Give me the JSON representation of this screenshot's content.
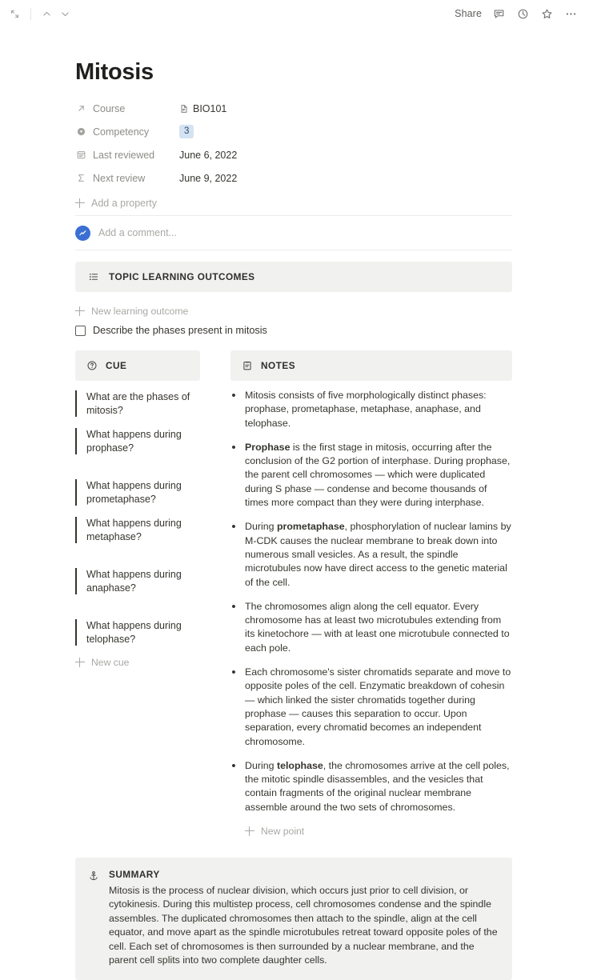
{
  "topbar": {
    "left_icons": [
      {
        "name": "expand-collapse-icon"
      },
      {
        "name": "chevron-up-icon"
      },
      {
        "name": "chevron-down-icon"
      }
    ],
    "share_label": "Share",
    "right_icons": [
      {
        "name": "comment-icon"
      },
      {
        "name": "history-clock-icon"
      },
      {
        "name": "star-icon"
      },
      {
        "name": "more-options-icon"
      }
    ]
  },
  "page": {
    "title": "Mitosis",
    "properties": [
      {
        "icon": "relation-arrow-icon",
        "name": "Course",
        "type": "relation",
        "value": "BIO101"
      },
      {
        "icon": "select-circle-icon",
        "name": "Competency",
        "type": "badge",
        "value": "3"
      },
      {
        "icon": "calendar-icon",
        "name": "Last reviewed",
        "type": "text",
        "value": "June 6, 2022"
      },
      {
        "icon": "sigma-formula-icon",
        "name": "Next review",
        "type": "text",
        "value": "June 9, 2022"
      }
    ],
    "add_property_label": "Add a property",
    "comment_placeholder": "Add a comment..."
  },
  "learning_outcomes": {
    "header_icon": "bulleted-list-icon",
    "header_label": "TOPIC LEARNING OUTCOMES",
    "add_label": "New learning outcome",
    "items": [
      {
        "checked": false,
        "text": "Describe the phases present in mitosis"
      }
    ]
  },
  "cue": {
    "header_icon": "question-circle-icon",
    "header_label": "CUE",
    "items": [
      "What are the phases of mitosis?",
      "What happens during prophase?",
      "What happens during prometaphase?",
      "What happens during metaphase?",
      "What happens during anaphase?",
      "What happens during telophase?"
    ],
    "add_label": "New cue"
  },
  "notes": {
    "header_icon": "clipboard-notes-icon",
    "header_label": "NOTES",
    "items": [
      {
        "html": "Mitosis consists of five morphologically distinct phases: prophase, prometaphase, metaphase, anaphase, and telophase."
      },
      {
        "html": "<b>Prophase</b> is the first stage in mitosis, occurring after the conclusion of the G2 portion of interphase. During prophase, the parent cell chromosomes &mdash; which were duplicated during S phase &mdash; condense and become thousands of times more compact than they were during interphase."
      },
      {
        "html": "During <b>prometaphase</b>, phosphorylation of nuclear lamins by M-CDK causes the nuclear membrane to break down into numerous small vesicles. As a result, the spindle microtubules now have direct access to the genetic material of the cell."
      },
      {
        "html": "The chromosomes align along the cell equator. Every chromosome has at least two microtubules extending from its kinetochore &mdash; with at least one microtubule connected to each pole."
      },
      {
        "html": "Each chromosome's sister chromatids separate and move to opposite poles of the cell. Enzymatic breakdown of cohesin &mdash; which linked the sister chromatids together during prophase &mdash; causes this separation to occur. Upon separation, every chromatid becomes an independent chromosome."
      },
      {
        "html": "During <b>telophase</b>, the chromosomes arrive at the cell poles, the mitotic spindle disassembles, and the vesicles that contain fragments of the original nuclear membrane assemble around the two sets of chromosomes."
      }
    ],
    "add_label": "New point"
  },
  "summary": {
    "header_icon": "anchor-icon",
    "header_label": "SUMMARY",
    "body": "Mitosis is the process of nuclear division, which occurs just prior to cell division, or cytokinesis. During this multistep process, cell chromosomes condense and the spindle assembles. The duplicated chromosomes then attach to the spindle, align at the cell equator, and move apart as the spindle microtubules retreat toward opposite poles of the cell. Each set of chromosomes is then surrounded by a nuclear membrane, and the parent cell splits into two complete daughter cells."
  },
  "colors": {
    "band_background": "#f1f1ef",
    "badge_background": "#d3e3f3",
    "avatar_background": "#3b6fd4",
    "text": "#37352f",
    "muted_text": "#a9a8a4"
  }
}
